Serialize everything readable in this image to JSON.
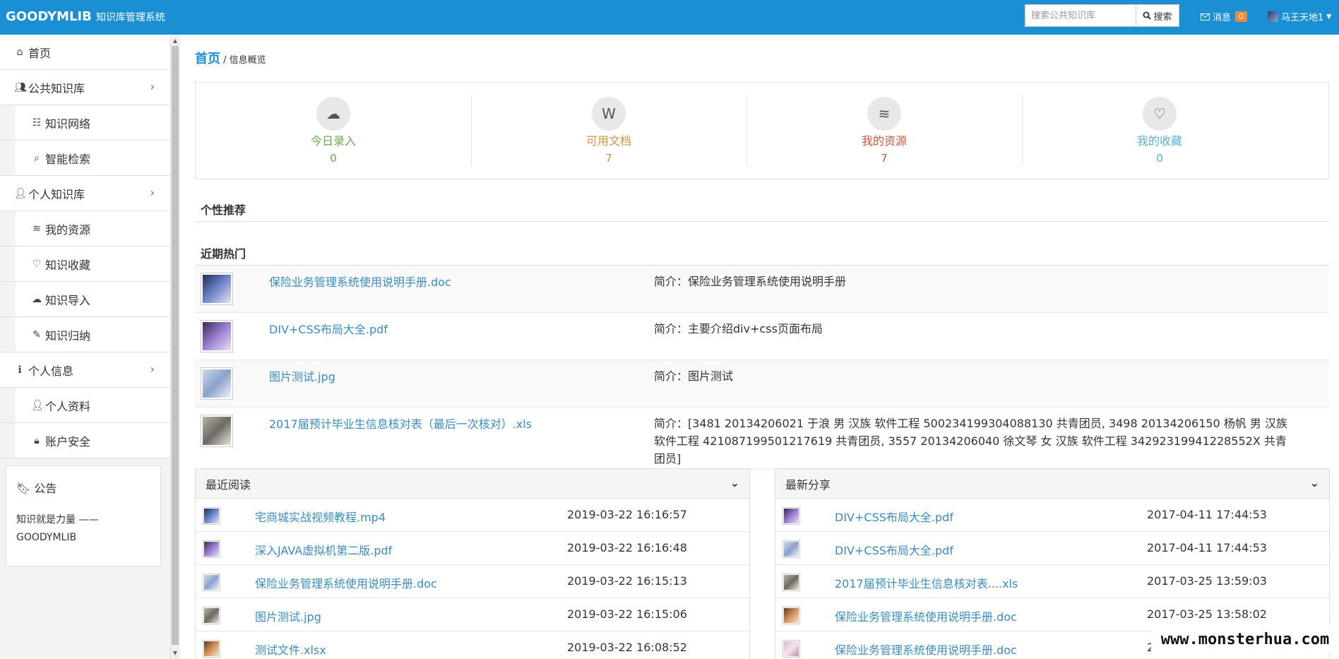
{
  "navbar": {
    "brand": "GOODYMLIB",
    "brand_sub": "知识库管理系统",
    "search_placeholder": "搜索公共知识库",
    "search_button": "搜索",
    "messages_label": "消息",
    "messages_count": "0",
    "user_name": "马王天地1"
  },
  "sidebar": {
    "items": [
      {
        "label": "首页",
        "icon": "home-icon",
        "sub": false
      },
      {
        "label": "公共知识库",
        "icon": "users-icon",
        "sub": false,
        "chevron": true
      },
      {
        "label": "知识网络",
        "icon": "sitemap-icon",
        "sub": true
      },
      {
        "label": "智能检索",
        "icon": "search-icon",
        "sub": true
      },
      {
        "label": "个人知识库",
        "icon": "user-icon",
        "sub": false,
        "chevron": true
      },
      {
        "label": "我的资源",
        "icon": "database-icon",
        "sub": true
      },
      {
        "label": "知识收藏",
        "icon": "heart-icon",
        "sub": true
      },
      {
        "label": "知识导入",
        "icon": "cloud-upload-icon",
        "sub": true
      },
      {
        "label": "知识归纳",
        "icon": "edit-icon",
        "sub": true
      },
      {
        "label": "个人信息",
        "icon": "info-icon",
        "sub": false,
        "chevron": true
      },
      {
        "label": "个人资料",
        "icon": "user-icon",
        "sub": true
      },
      {
        "label": "账户安全",
        "icon": "lock-icon",
        "sub": true
      }
    ],
    "notice_title": "公告",
    "notice_text": "知识就是力量 —— GOODYMLIB"
  },
  "breadcrumb": {
    "home": "首页",
    "sep": "/",
    "current": "信息概览"
  },
  "stats": [
    {
      "label": "今日录入",
      "value": "0",
      "icon": "cloud-upload-icon",
      "color": "#6aa84f"
    },
    {
      "label": "可用文档",
      "value": "7",
      "icon": "word-doc-icon",
      "color": "#d4923c"
    },
    {
      "label": "我的资源",
      "value": "7",
      "icon": "database-icon",
      "color": "#c9573e"
    },
    {
      "label": "我的收藏",
      "value": "0",
      "icon": "heart-icon",
      "color": "#5bafd4"
    }
  ],
  "sections": {
    "personal": "个性推荐",
    "hot": "近期热门"
  },
  "hot": [
    {
      "name": "保险业务管理系统使用说明手册.doc",
      "intro": "简介：保险业务管理系统使用说明手册"
    },
    {
      "name": "DIV+CSS布局大全.pdf",
      "intro": "简介：主要介绍div+css页面布局"
    },
    {
      "name": "图片测试.jpg",
      "intro": "简介：图片测试"
    },
    {
      "name": "2017届预计毕业生信息核对表（最后一次核对）.xls",
      "intro": "简介：[3481 20134206021 于浪 男 汉族 软件工程 500234199304088130 共青团员, 3498 20134206150 杨帆 男 汉族 软件工程 421087199501217619 共青团员, 3557 20134206040 徐文琴 女 汉族 软件工程 34292319941228552X 共青团员]"
    }
  ],
  "recent": {
    "title": "最近阅读",
    "rows": [
      {
        "name": "宅商城实战视频教程.mp4",
        "time": "2019-03-22 16:16:57"
      },
      {
        "name": "深入JAVA虚拟机第二版.pdf",
        "time": "2019-03-22 16:16:48"
      },
      {
        "name": "保险业务管理系统使用说明手册.doc",
        "time": "2019-03-22 16:15:13"
      },
      {
        "name": "图片测试.jpg",
        "time": "2019-03-22 16:15:06"
      },
      {
        "name": "测试文件.xlsx",
        "time": "2019-03-22 16:08:52"
      }
    ]
  },
  "shared": {
    "title": "最新分享",
    "rows": [
      {
        "name": "DIV+CSS布局大全.pdf",
        "time": "2017-04-11 17:44:53"
      },
      {
        "name": "DIV+CSS布局大全.pdf",
        "time": "2017-04-11 17:44:53"
      },
      {
        "name": "2017届预计毕业生信息核对表....xls",
        "time": "2017-03-25 13:59:03"
      },
      {
        "name": "保险业务管理系统使用说明手册.doc",
        "time": "2017-03-25 13:58:02"
      },
      {
        "name": "保险业务管理系统使用说明手册.doc",
        "time": "2"
      }
    ]
  },
  "watermark": "www.monsterhua.com"
}
